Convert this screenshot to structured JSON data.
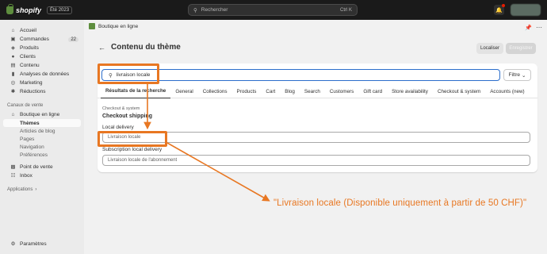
{
  "topbar": {
    "brand": "shopify",
    "edition": "Été 2023",
    "search_placeholder": "Rechercher",
    "search_shortcut": "Ctrl K"
  },
  "sidebar": {
    "items": [
      {
        "label": "Accueil",
        "icon": "home-icon"
      },
      {
        "label": "Commandes",
        "icon": "orders-icon",
        "count": "22"
      },
      {
        "label": "Produits",
        "icon": "tag-icon"
      },
      {
        "label": "Clients",
        "icon": "person-icon"
      },
      {
        "label": "Contenu",
        "icon": "content-icon"
      },
      {
        "label": "Analyses de données",
        "icon": "chart-icon"
      },
      {
        "label": "Marketing",
        "icon": "target-icon"
      },
      {
        "label": "Réductions",
        "icon": "discount-icon"
      }
    ],
    "sales_channels_title": "Canaux de vente",
    "online_store": "Boutique en ligne",
    "online_store_sub": [
      "Thèmes",
      "Articles de blog",
      "Pages",
      "Navigation",
      "Préférences"
    ],
    "pos": "Point de vente",
    "inbox": "Inbox",
    "applications": "Applications",
    "settings": "Paramètres"
  },
  "breadcrumb": "Boutique en ligne",
  "page": {
    "title": "Contenu du thème",
    "localize_button": "Localiser",
    "save_button": "Enregistrer"
  },
  "search": {
    "value": "livraison locale",
    "filter_button": "Filtre"
  },
  "tabs": [
    "Résultats de la recherche",
    "General",
    "Collections",
    "Products",
    "Cart",
    "Blog",
    "Search",
    "Customers",
    "Gift card",
    "Store availability",
    "Checkout & system",
    "Accounts (new)"
  ],
  "results": {
    "section_label": "Checkout & system",
    "section_title": "Checkout shipping",
    "field1_label": "Local delivery",
    "field1_value": "Livraison locale",
    "field2_label": "Subscription local delivery",
    "field2_value": "Livraison locale de l'abonnement"
  },
  "annotation": {
    "callout": "\"Livraison locale (Disponible uniquement à partir de 50 CHF)\"",
    "color": "#e87722"
  }
}
